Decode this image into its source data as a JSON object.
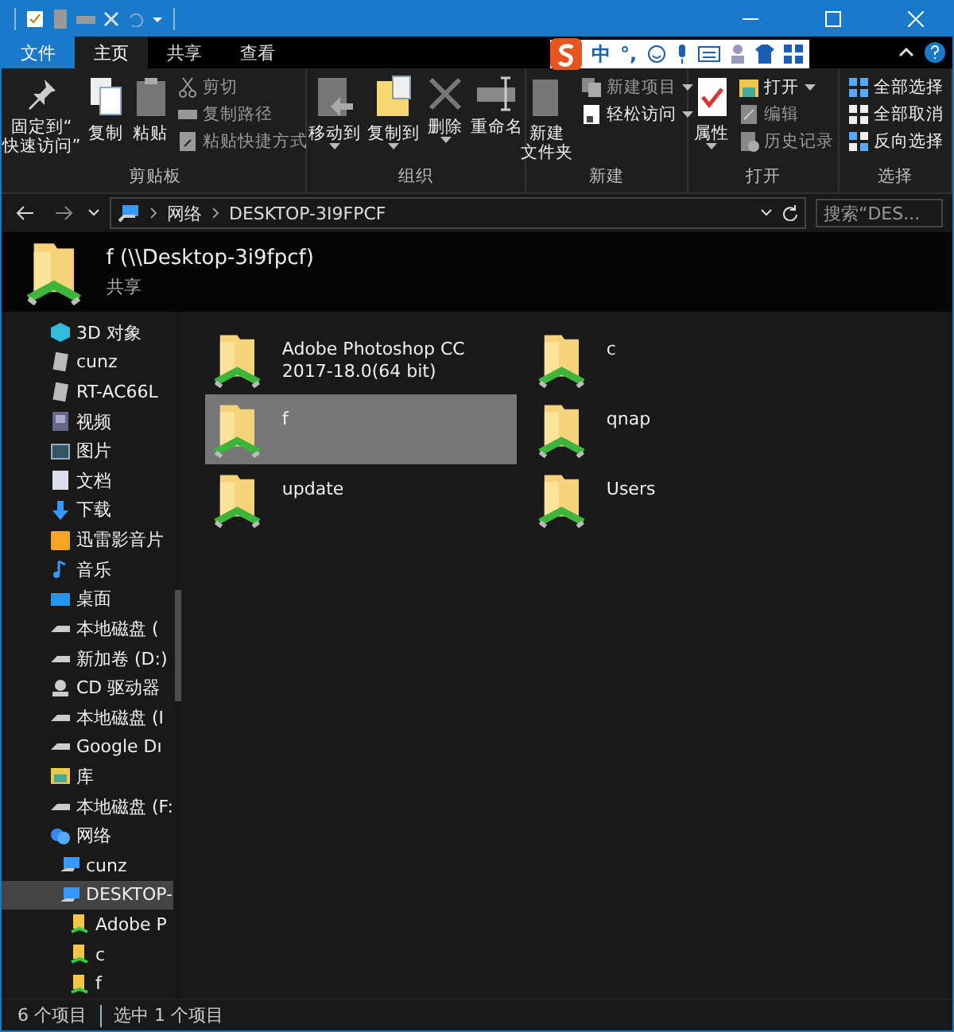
{
  "ribbon_tabs": [
    {
      "label": "文件",
      "kind": "file",
      "selected": false
    },
    {
      "label": "主页",
      "kind": "tab",
      "selected": true
    },
    {
      "label": "共享",
      "kind": "tab",
      "selected": false
    },
    {
      "label": "查看",
      "kind": "tab",
      "selected": false
    }
  ],
  "ime_bar": {
    "mode": "中",
    "punctuation": "°,"
  },
  "ribbon_groups": [
    {
      "name": "剪贴板",
      "large_buttons": [
        {
          "lines": [
            "固定到“",
            "快速访问”"
          ],
          "dropdown": false
        },
        {
          "lines": [
            "复制"
          ],
          "dropdown": false
        },
        {
          "lines": [
            "粘贴"
          ],
          "dropdown": false
        }
      ],
      "small_buttons": [
        {
          "label": "剪切",
          "dropdown": false,
          "disabled": true
        },
        {
          "label": "复制路径",
          "dropdown": false,
          "disabled": true
        },
        {
          "label": "粘贴快捷方式",
          "dropdown": false,
          "disabled": true
        }
      ]
    },
    {
      "name": "组织",
      "large_buttons": [
        {
          "lines": [
            "移动到"
          ],
          "dropdown": true
        },
        {
          "lines": [
            "复制到"
          ],
          "dropdown": true
        },
        {
          "lines": [
            "删除"
          ],
          "dropdown": true
        },
        {
          "lines": [
            "重命名"
          ],
          "dropdown": false
        }
      ]
    },
    {
      "name": "新建",
      "large_buttons": [
        {
          "lines": [
            "新建",
            "文件夹"
          ],
          "dropdown": false
        }
      ],
      "small_buttons": [
        {
          "label": "新建项目",
          "dropdown": true,
          "disabled": true
        },
        {
          "label": "轻松访问",
          "dropdown": true,
          "disabled": false
        }
      ]
    },
    {
      "name": "打开",
      "large_buttons": [
        {
          "lines": [
            "属性"
          ],
          "dropdown": true
        }
      ],
      "small_buttons": [
        {
          "label": "打开",
          "dropdown": true,
          "disabled": false
        },
        {
          "label": "编辑",
          "dropdown": false,
          "disabled": true
        },
        {
          "label": "历史记录",
          "dropdown": false,
          "disabled": true
        }
      ]
    },
    {
      "name": "选择",
      "small_buttons": [
        {
          "label": "全部选择",
          "dropdown": false,
          "disabled": false
        },
        {
          "label": "全部取消",
          "dropdown": false,
          "disabled": false
        },
        {
          "label": "反向选择",
          "dropdown": false,
          "disabled": false
        }
      ]
    }
  ],
  "address_bar": {
    "path": [
      "网络",
      "DESKTOP-3I9FPCF"
    ],
    "search_placeholder": "搜索“DES..."
  },
  "header": {
    "title": "f (\\\\Desktop-3i9fpcf)",
    "subtitle": "共享"
  },
  "navigation": [
    {
      "label": "3D 对象",
      "kind": "cube",
      "selected": false
    },
    {
      "label": "cunz",
      "kind": "network-drive",
      "selected": false
    },
    {
      "label": "RT-AC66L",
      "kind": "network-drive",
      "selected": false
    },
    {
      "label": "视频",
      "kind": "video",
      "selected": false
    },
    {
      "label": "图片",
      "kind": "picture",
      "selected": false
    },
    {
      "label": "文档",
      "kind": "document",
      "selected": false
    },
    {
      "label": "下载",
      "kind": "download",
      "selected": false
    },
    {
      "label": "迅雷影音片",
      "kind": "app-folder",
      "selected": false
    },
    {
      "label": "音乐",
      "kind": "music",
      "selected": false
    },
    {
      "label": "桌面",
      "kind": "desktop",
      "selected": false
    },
    {
      "label": "本地磁盘 (",
      "kind": "disk",
      "selected": false
    },
    {
      "label": "新加卷 (D:)",
      "kind": "disk",
      "selected": false
    },
    {
      "label": "CD 驱动器",
      "kind": "cd",
      "selected": false
    },
    {
      "label": "本地磁盘 (I",
      "kind": "disk",
      "selected": false
    },
    {
      "label": "Google Dı",
      "kind": "disk",
      "selected": false
    },
    {
      "label": "库",
      "kind": "library",
      "selected": false
    },
    {
      "label": "本地磁盘 (F:",
      "kind": "disk",
      "selected": false
    },
    {
      "label": "网络",
      "kind": "network",
      "selected": false,
      "children": [
        {
          "label": "cunz",
          "kind": "computer",
          "selected": false
        },
        {
          "label": "DESKTOP-",
          "kind": "computer",
          "selected": true,
          "children": [
            {
              "label": "Adobe P",
              "kind": "shared-folder",
              "selected": false
            },
            {
              "label": "c",
              "kind": "shared-folder",
              "selected": false
            },
            {
              "label": "f",
              "kind": "shared-folder",
              "selected": false
            }
          ]
        }
      ]
    }
  ],
  "items": [
    {
      "name": "Adobe Photoshop CC\n2017-18.0(64 bit)",
      "selected": false
    },
    {
      "name": "c",
      "selected": false
    },
    {
      "name": "f",
      "selected": true
    },
    {
      "name": "qnap",
      "selected": false
    },
    {
      "name": "update",
      "selected": false
    },
    {
      "name": "Users",
      "selected": false
    }
  ],
  "status_bar": {
    "item_count": "6 个项目",
    "selection": "选中 1 个项目"
  }
}
